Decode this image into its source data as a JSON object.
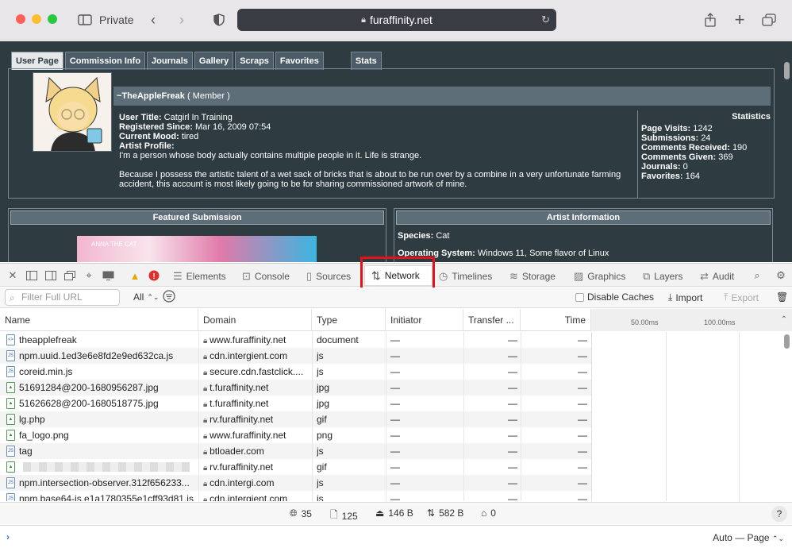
{
  "browser": {
    "private_label": "Private",
    "url": "furaffinity.net",
    "colors": {
      "red": "#fe5f57",
      "yellow": "#febc2e",
      "green": "#28c840"
    }
  },
  "site": {
    "tabs": [
      "User Page",
      "Commission Info",
      "Journals",
      "Gallery",
      "Scraps",
      "Favorites",
      "Stats"
    ],
    "username": "~TheAppleFreak",
    "role": "( Member )",
    "user_title_label": "User Title:",
    "user_title": "Catgirl In Training",
    "registered_label": "Registered Since:",
    "registered": "Mar 16, 2009 07:54",
    "mood_label": "Current Mood:",
    "mood": "tired",
    "profile_label": "Artist Profile:",
    "profile_line1": "I'm a person whose body actually contains multiple people in it. Life is strange.",
    "profile_line2": "Because I possess the artistic talent of a wet sack of bricks that is about to be run over by a combine in a very unfortunate farming accident, this account is most likely going to be for sharing commissioned artwork of mine.",
    "stats_title": "Statistics",
    "stats": [
      {
        "label": "Page Visits:",
        "value": "1242"
      },
      {
        "label": "Submissions:",
        "value": "24"
      },
      {
        "label": "Comments Received:",
        "value": "190"
      },
      {
        "label": "Comments Given:",
        "value": "369"
      },
      {
        "label": "Journals:",
        "value": "0"
      },
      {
        "label": "Favorites:",
        "value": "164"
      }
    ],
    "featured_title": "Featured Submission",
    "featured_caption": "ANNA THE CAT",
    "artist_info_title": "Artist Information",
    "species_label": "Species:",
    "species": "Cat",
    "os_label": "Operating System:",
    "os": "Windows 11, Some flavor of Linux"
  },
  "devtools": {
    "tabs": [
      "Elements",
      "Console",
      "Sources",
      "Network",
      "Timelines",
      "Storage",
      "Graphics",
      "Layers",
      "Audit"
    ],
    "filter_placeholder": "Filter Full URL",
    "all_label": "All",
    "disable_caches": "Disable Caches",
    "import": "Import",
    "export": "Export",
    "columns": [
      "Name",
      "Domain",
      "Type",
      "Initiator",
      "Transfer ...",
      "Time"
    ],
    "timeline_ticks": [
      "50.00ms",
      "100.00ms"
    ],
    "rows": [
      {
        "name": "theapplefreak",
        "domain": "www.furaffinity.net",
        "type": "document",
        "icon": "doc"
      },
      {
        "name": "npm.uuid.1ed3e6e8fd2e9ed632ca.js",
        "domain": "cdn.intergient.com",
        "type": "js",
        "icon": "js"
      },
      {
        "name": "coreid.min.js",
        "domain": "secure.cdn.fastclick....",
        "type": "js",
        "icon": "js"
      },
      {
        "name": "51691284@200-1680956287.jpg",
        "domain": "t.furaffinity.net",
        "type": "jpg",
        "icon": "img"
      },
      {
        "name": "51626628@200-1680518775.jpg",
        "domain": "t.furaffinity.net",
        "type": "jpg",
        "icon": "img"
      },
      {
        "name": "lg.php",
        "domain": "rv.furaffinity.net",
        "type": "gif",
        "icon": "img"
      },
      {
        "name": "fa_logo.png",
        "domain": "www.furaffinity.net",
        "type": "png",
        "icon": "img"
      },
      {
        "name": "tag",
        "domain": "btloader.com",
        "type": "js",
        "icon": "js"
      },
      {
        "name": "",
        "domain": "rv.furaffinity.net",
        "type": "gif",
        "icon": "img"
      },
      {
        "name": "npm.intersection-observer.312f656233...",
        "domain": "cdn.intergi.com",
        "type": "js",
        "icon": "js"
      },
      {
        "name": "npm.base64-js.e1a1780355e1cff93d81.js",
        "domain": "cdn.intergient.com",
        "type": "js",
        "icon": "js"
      }
    ],
    "dash": "—",
    "summary": {
      "requests": "35",
      "resources": "125",
      "transferred": "146 B",
      "size": "582 B",
      "time": "0"
    },
    "help": "?",
    "context": "Auto — Page"
  }
}
